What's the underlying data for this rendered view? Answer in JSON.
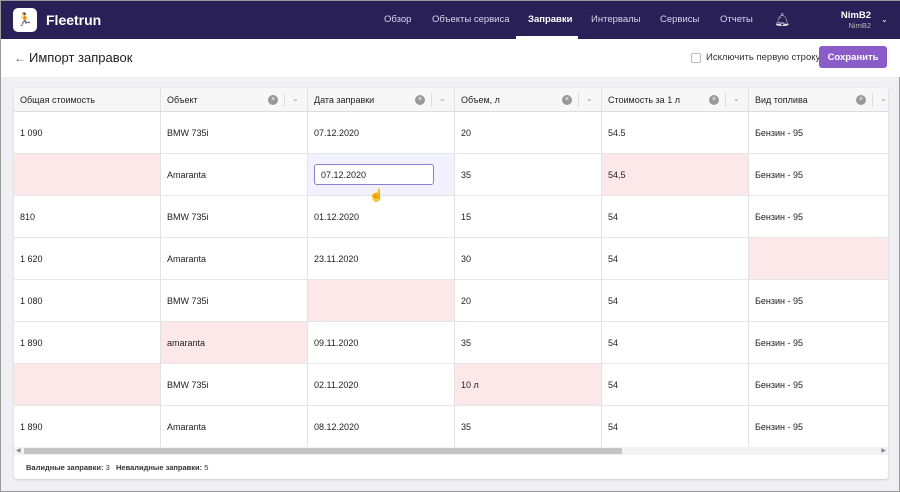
{
  "app": {
    "brand": "Fleetrun",
    "logo_icon": "runner-logo"
  },
  "nav": {
    "items": [
      "Обзор",
      "Объекты сервиса",
      "Заправки",
      "Интервалы",
      "Сервисы",
      "Отчеты"
    ],
    "active": "Заправки",
    "user_name": "NimB2",
    "user_sub": "NimB2"
  },
  "header": {
    "title": "Импорт заправок",
    "exclude_first_row": "Исключить первую строку",
    "exclude_checked": false,
    "save_label": "Сохранить"
  },
  "table": {
    "columns": [
      "Общая стоимость",
      "Объект",
      "Дата заправки",
      "Объем, л",
      "Стоимость за 1 л",
      "Вид топлива"
    ],
    "rows": [
      {
        "cells": [
          "1 090",
          "BMW 735i",
          "07.12.2020",
          "20",
          "54.5",
          "Бензин - 95"
        ],
        "errors": []
      },
      {
        "cells": [
          "",
          "Amaranta",
          "07.12.2020",
          "35",
          "54,5",
          "Бензин - 95"
        ],
        "errors": [
          0,
          4
        ],
        "editing": 2
      },
      {
        "cells": [
          "810",
          "BMW 735i",
          "01.12.2020",
          "15",
          "54",
          "Бензин - 95"
        ],
        "errors": []
      },
      {
        "cells": [
          "1 620",
          "Amaranta",
          "23.11.2020",
          "30",
          "54",
          ""
        ],
        "errors": [
          5
        ]
      },
      {
        "cells": [
          "1 080",
          "BMW 735i",
          "",
          "20",
          "54",
          "Бензин - 95"
        ],
        "errors": [
          2
        ]
      },
      {
        "cells": [
          "1 890",
          "amaranta",
          "09.11.2020",
          "35",
          "54",
          "Бензин - 95"
        ],
        "errors": [
          1
        ]
      },
      {
        "cells": [
          "",
          "BMW 735i",
          "02.11.2020",
          "10 л",
          "54",
          "Бензин - 95"
        ],
        "errors": [
          0,
          3
        ]
      },
      {
        "cells": [
          "1 890",
          "Amaranta",
          "08.12.2020",
          "35",
          "54",
          "Бензин - 95"
        ],
        "errors": []
      }
    ]
  },
  "footer": {
    "valid_label": "Валидные заправки:",
    "valid_count": "3",
    "invalid_label": "Невалидные заправки:",
    "invalid_count": "5"
  },
  "colors": {
    "nav": "#2a2058",
    "accent": "#8a5cc7",
    "error": "#fde8e9"
  }
}
